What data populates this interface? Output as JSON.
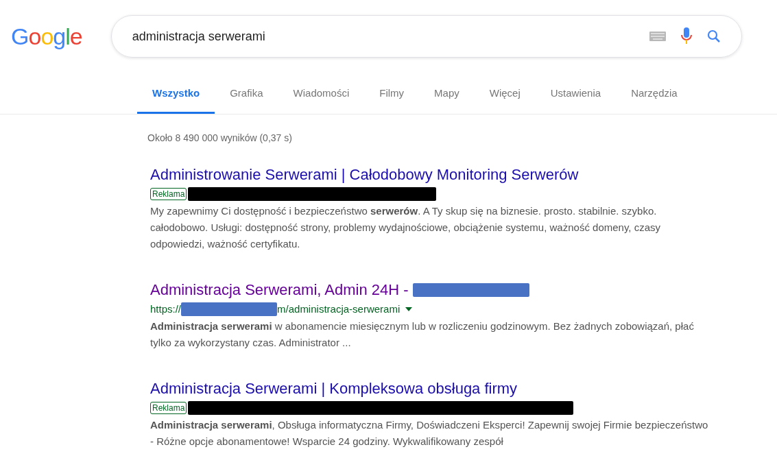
{
  "logo": "Google",
  "search": {
    "value": "administracja serwerami"
  },
  "tabs": [
    {
      "label": "Wszystko",
      "selected": true
    },
    {
      "label": "Grafika",
      "selected": false
    },
    {
      "label": "Wiadomości",
      "selected": false
    },
    {
      "label": "Filmy",
      "selected": false
    },
    {
      "label": "Mapy",
      "selected": false
    },
    {
      "label": "Więcej",
      "selected": false
    },
    {
      "label": "Ustawienia",
      "selected": false
    },
    {
      "label": "Narzędzia",
      "selected": false
    }
  ],
  "result_stats": "Około 8 490 000 wyników (0,37 s)",
  "results": [
    {
      "kind": "ad",
      "title": "Administrowanie Serwerami | Całodobowy Monitoring Serwerów",
      "visited": false,
      "badge": "Reklama",
      "color": "#000000",
      "snippet": "My zapewnimy Ci dostępność i bezpieczeństwo **serwerów**. A Ty skup się na biznesie. prosto. stabilnie. szybko. całodobowo. Usługi: dostępność strony, problemy wydajnościowe, obciążenie systemu, ważność domeny, czasy odpowiedzi, ważność certyfikatu."
    },
    {
      "kind": "organic",
      "title": "Administracja Serwerami, Admin 24H -",
      "visited": true,
      "url_start": "https://",
      "url_end": "m/administracja-serwerami",
      "color": "#4a72c4",
      "snippet": "**Administracja serwerami** w abonamencie miesięcznym lub w rozliczeniu godzinowym. Bez żadnych zobowiązań, płać tylko za wykorzystany czas. Administrator ..."
    },
    {
      "kind": "ad",
      "title": "Administracja Serwerami | Kompleksowa obsługa firmy",
      "visited": false,
      "badge": "Reklama",
      "color": "#000000",
      "snippet": "**Administracja serwerami**, Obsługa informatyczna Firmy, Doświadczeni Eksperci! Zapewnij swojej Firmie bezpieczeństwo - Różne opcje abonamentowe! Wsparcie 24 godziny. Wykwalifikowany zespół"
    }
  ]
}
